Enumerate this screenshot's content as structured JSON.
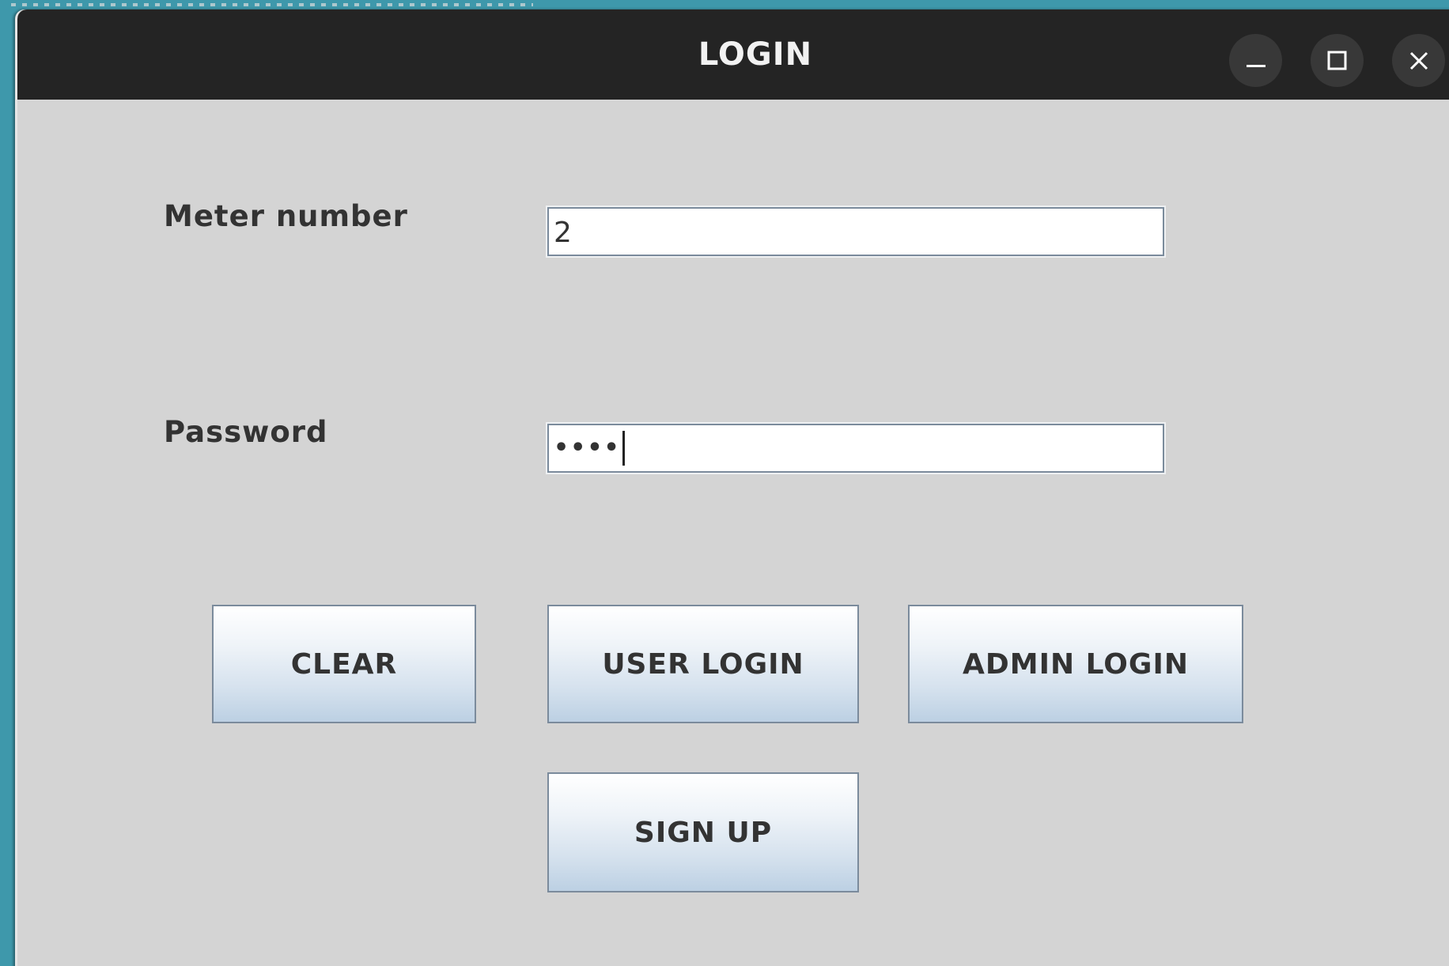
{
  "window": {
    "title": "LOGIN",
    "controls": {
      "minimize": "minimize-icon",
      "maximize": "maximize-icon",
      "close": "close-icon"
    }
  },
  "form": {
    "meter_label": "Meter number",
    "meter_value": "2",
    "password_label": "Password",
    "password_masked": "••••"
  },
  "buttons": {
    "clear": "CLEAR",
    "user_login": "USER LOGIN",
    "admin_login": "ADMIN LOGIN",
    "sign_up": "SIGN UP"
  },
  "colors": {
    "desktop": "#3e98ab",
    "titlebar": "#242424",
    "window_bg": "#d4d4d4",
    "button_gradient_bottom": "#bcd0e3"
  }
}
